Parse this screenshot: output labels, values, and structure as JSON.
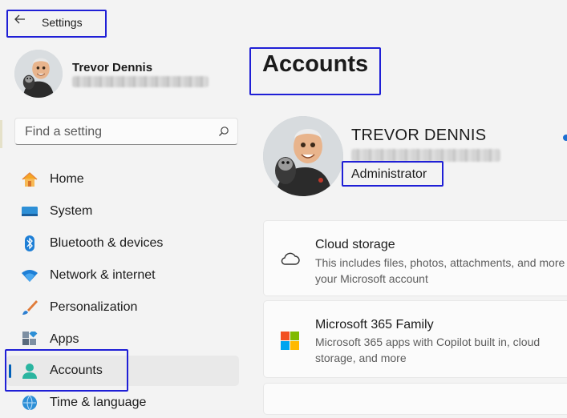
{
  "titlebar": {
    "title": "Settings"
  },
  "profile": {
    "name": "Trevor Dennis"
  },
  "search": {
    "placeholder": "Find a setting"
  },
  "nav": {
    "items": [
      {
        "label": "Home",
        "icon": "home-icon"
      },
      {
        "label": "System",
        "icon": "system-icon"
      },
      {
        "label": "Bluetooth & devices",
        "icon": "bluetooth-icon"
      },
      {
        "label": "Network & internet",
        "icon": "wifi-icon"
      },
      {
        "label": "Personalization",
        "icon": "brush-icon"
      },
      {
        "label": "Apps",
        "icon": "apps-icon"
      },
      {
        "label": "Accounts",
        "icon": "accounts-icon",
        "selected": true
      },
      {
        "label": "Time & language",
        "icon": "globe-icon"
      }
    ]
  },
  "main": {
    "title": "Accounts",
    "user": {
      "name": "TREVOR DENNIS",
      "role": "Administrator"
    },
    "cards": [
      {
        "title": "Cloud storage",
        "description": "This includes files, photos, attachments, and more in your Microsoft account",
        "icon": "cloud-icon"
      },
      {
        "title": "Microsoft 365 Family",
        "description": "Microsoft 365 apps with Copilot built in, cloud storage, and more",
        "icon": "microsoft-logo-icon"
      }
    ]
  },
  "colors": {
    "accent": "#005fb8",
    "highlight_box": "#1f1fd6",
    "background": "#f3f3f3"
  }
}
